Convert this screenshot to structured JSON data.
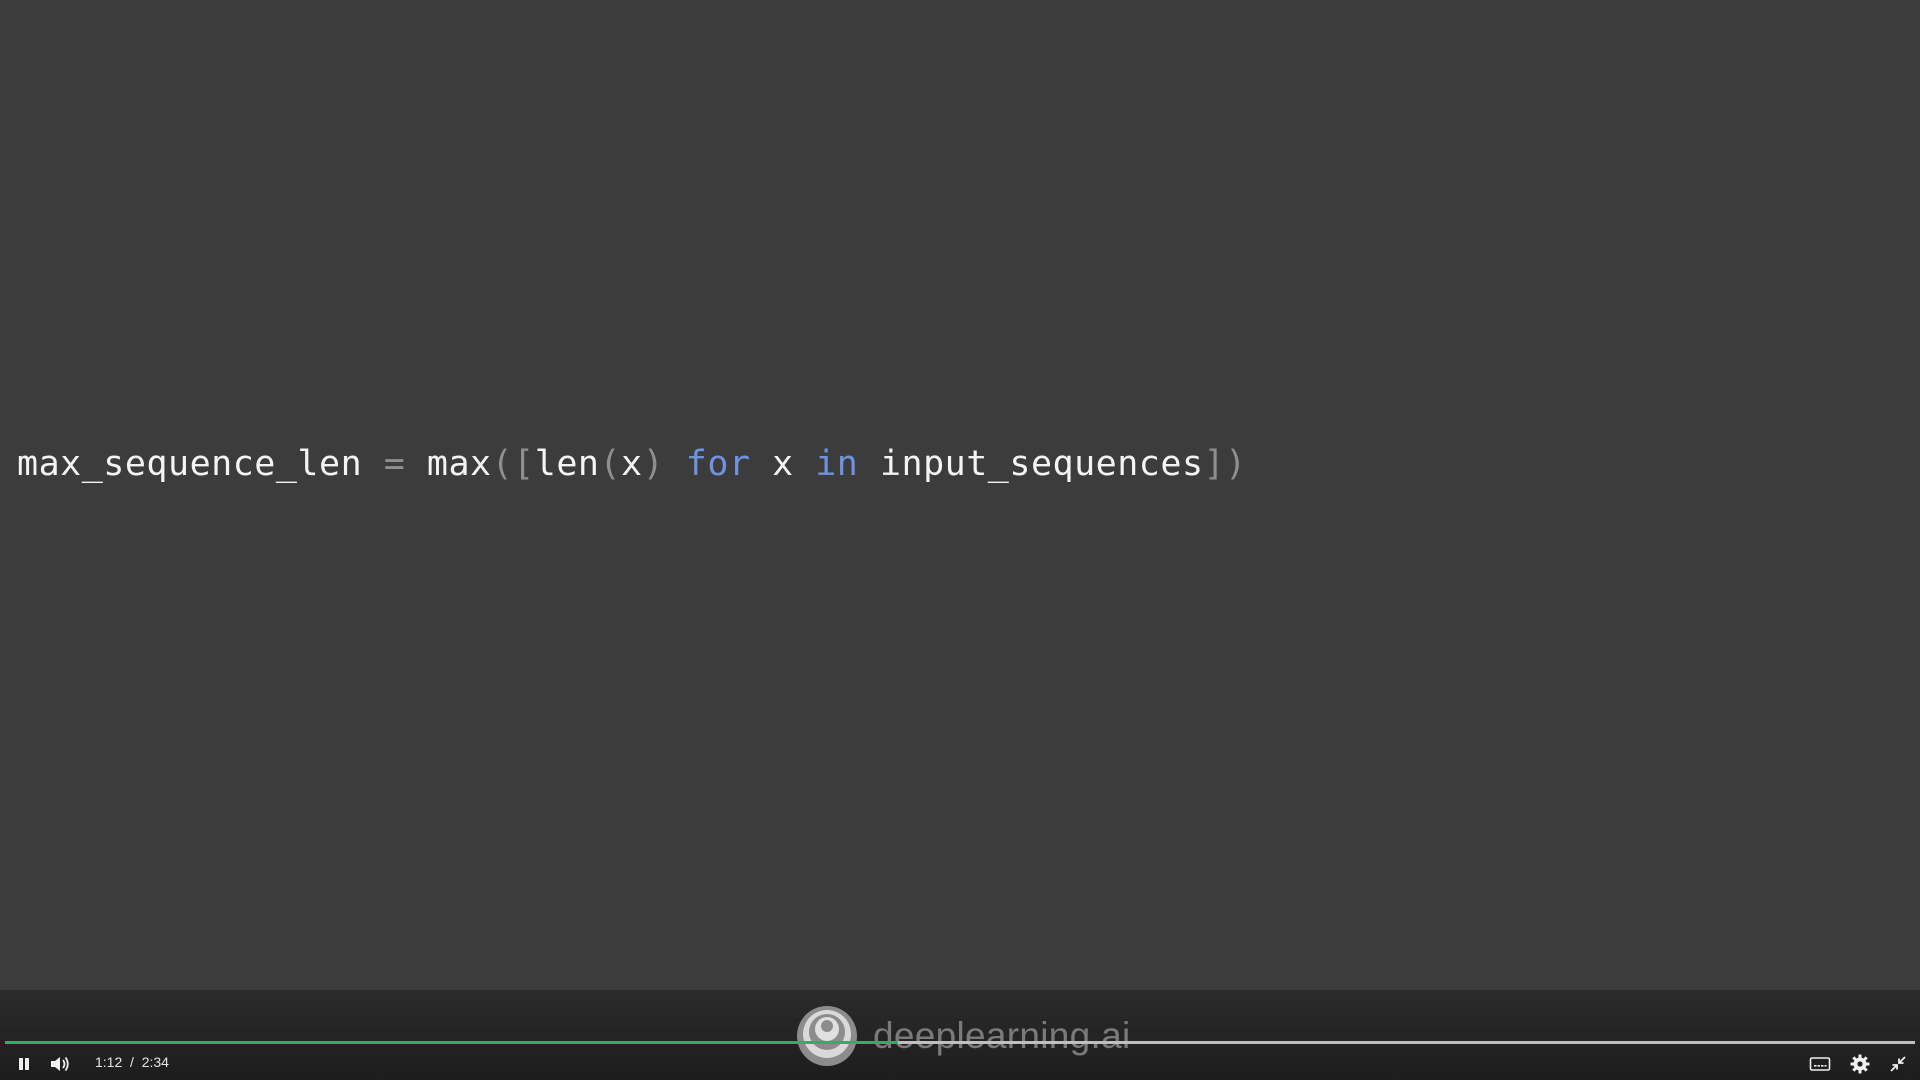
{
  "video": {
    "code_tokens": [
      {
        "text": "max_sequence_len",
        "kind": "ident"
      },
      {
        "text": " = ",
        "kind": "punct"
      },
      {
        "text": "max",
        "kind": "ident"
      },
      {
        "text": "([",
        "kind": "punct"
      },
      {
        "text": "len",
        "kind": "ident"
      },
      {
        "text": "(",
        "kind": "punct"
      },
      {
        "text": "x",
        "kind": "ident"
      },
      {
        "text": ") ",
        "kind": "punct"
      },
      {
        "text": "for",
        "kind": "kw"
      },
      {
        "text": " x ",
        "kind": "ident"
      },
      {
        "text": "in",
        "kind": "kw"
      },
      {
        "text": " input_sequences",
        "kind": "ident"
      },
      {
        "text": "])",
        "kind": "punct"
      }
    ],
    "colors": {
      "background": "#3c3c3c",
      "identifier": "#f4f4f4",
      "keyword": "#6f93e0",
      "punctuation": "#8f8f8f"
    }
  },
  "brand": {
    "name": "deeplearning.ai",
    "logo_icon": "deeplearning-spiral-logo"
  },
  "player": {
    "progress_fraction": 0.4675,
    "progress_color": "#2fae69",
    "current_time": "1:12",
    "separator": "/",
    "duration": "2:34",
    "controls": {
      "play_pause_icon": "pause-icon",
      "volume_icon": "volume-icon",
      "captions_icon": "captions-icon",
      "settings_icon": "gear-icon",
      "fullscreen_icon": "exit-fullscreen-icon"
    }
  }
}
